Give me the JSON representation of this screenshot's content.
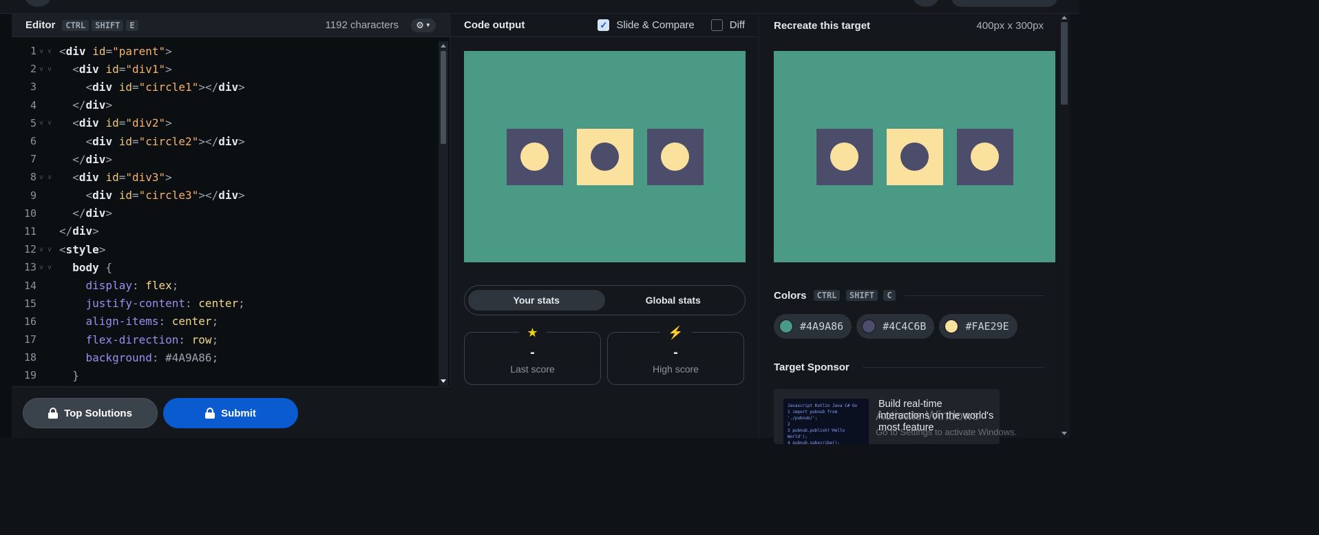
{
  "editor": {
    "title": "Editor",
    "shortcut": [
      "CTRL",
      "SHIFT",
      "E"
    ],
    "char_count": "1192 characters",
    "settings_icon": "gear-icon"
  },
  "code_lines": [
    {
      "n": "1",
      "fold": true,
      "tokens": [
        [
          "punct",
          "<"
        ],
        [
          "tag",
          "div"
        ],
        [
          "punct",
          " "
        ],
        [
          "attr",
          "id"
        ],
        [
          "punct",
          "="
        ],
        [
          "str",
          "\"parent\""
        ],
        [
          "punct",
          ">"
        ]
      ]
    },
    {
      "n": "2",
      "fold": true,
      "tokens": [
        [
          "punct",
          "  <"
        ],
        [
          "tag",
          "div"
        ],
        [
          "punct",
          " "
        ],
        [
          "attr",
          "id"
        ],
        [
          "punct",
          "="
        ],
        [
          "str",
          "\"div1\""
        ],
        [
          "punct",
          ">"
        ]
      ]
    },
    {
      "n": "3",
      "fold": false,
      "tokens": [
        [
          "punct",
          "    <"
        ],
        [
          "tag",
          "div"
        ],
        [
          "punct",
          " "
        ],
        [
          "attr",
          "id"
        ],
        [
          "punct",
          "="
        ],
        [
          "str",
          "\"circle1\""
        ],
        [
          "punct",
          "></"
        ],
        [
          "tag",
          "div"
        ],
        [
          "punct",
          ">"
        ]
      ]
    },
    {
      "n": "4",
      "fold": false,
      "tokens": [
        [
          "punct",
          "  </"
        ],
        [
          "tag",
          "div"
        ],
        [
          "punct",
          ">"
        ]
      ]
    },
    {
      "n": "5",
      "fold": true,
      "tokens": [
        [
          "punct",
          "  <"
        ],
        [
          "tag",
          "div"
        ],
        [
          "punct",
          " "
        ],
        [
          "attr",
          "id"
        ],
        [
          "punct",
          "="
        ],
        [
          "str",
          "\"div2\""
        ],
        [
          "punct",
          ">"
        ]
      ]
    },
    {
      "n": "6",
      "fold": false,
      "tokens": [
        [
          "punct",
          "    <"
        ],
        [
          "tag",
          "div"
        ],
        [
          "punct",
          " "
        ],
        [
          "attr",
          "id"
        ],
        [
          "punct",
          "="
        ],
        [
          "str",
          "\"circle2\""
        ],
        [
          "punct",
          "></"
        ],
        [
          "tag",
          "div"
        ],
        [
          "punct",
          ">"
        ]
      ]
    },
    {
      "n": "7",
      "fold": false,
      "tokens": [
        [
          "punct",
          "  </"
        ],
        [
          "tag",
          "div"
        ],
        [
          "punct",
          ">"
        ]
      ]
    },
    {
      "n": "8",
      "fold": true,
      "tokens": [
        [
          "punct",
          "  <"
        ],
        [
          "tag",
          "div"
        ],
        [
          "punct",
          " "
        ],
        [
          "attr",
          "id"
        ],
        [
          "punct",
          "="
        ],
        [
          "str",
          "\"div3\""
        ],
        [
          "punct",
          ">"
        ]
      ]
    },
    {
      "n": "9",
      "fold": false,
      "tokens": [
        [
          "punct",
          "    <"
        ],
        [
          "tag",
          "div"
        ],
        [
          "punct",
          " "
        ],
        [
          "attr",
          "id"
        ],
        [
          "punct",
          "="
        ],
        [
          "str",
          "\"circle3\""
        ],
        [
          "punct",
          "></"
        ],
        [
          "tag",
          "div"
        ],
        [
          "punct",
          ">"
        ]
      ]
    },
    {
      "n": "10",
      "fold": false,
      "tokens": [
        [
          "punct",
          "  </"
        ],
        [
          "tag",
          "div"
        ],
        [
          "punct",
          ">"
        ]
      ]
    },
    {
      "n": "11",
      "fold": false,
      "tokens": [
        [
          "punct",
          "</"
        ],
        [
          "tag",
          "div"
        ],
        [
          "punct",
          ">"
        ]
      ]
    },
    {
      "n": "12",
      "fold": true,
      "tokens": [
        [
          "punct",
          "<"
        ],
        [
          "tag",
          "style"
        ],
        [
          "punct",
          ">"
        ]
      ]
    },
    {
      "n": "13",
      "fold": true,
      "tokens": [
        [
          "punct",
          "  "
        ],
        [
          "sel",
          "body"
        ],
        [
          "punct",
          " {"
        ]
      ]
    },
    {
      "n": "14",
      "fold": false,
      "tokens": [
        [
          "punct",
          "    "
        ],
        [
          "prop",
          "display"
        ],
        [
          "punct",
          ": "
        ],
        [
          "val",
          "flex"
        ],
        [
          "punct",
          ";"
        ]
      ]
    },
    {
      "n": "15",
      "fold": false,
      "tokens": [
        [
          "punct",
          "    "
        ],
        [
          "prop",
          "justify-content"
        ],
        [
          "punct",
          ": "
        ],
        [
          "val",
          "center"
        ],
        [
          "punct",
          ";"
        ]
      ]
    },
    {
      "n": "16",
      "fold": false,
      "tokens": [
        [
          "punct",
          "    "
        ],
        [
          "prop",
          "align-items"
        ],
        [
          "punct",
          ": "
        ],
        [
          "val",
          "center"
        ],
        [
          "punct",
          ";"
        ]
      ]
    },
    {
      "n": "17",
      "fold": false,
      "tokens": [
        [
          "punct",
          "    "
        ],
        [
          "prop",
          "flex-direction"
        ],
        [
          "punct",
          ": "
        ],
        [
          "val",
          "row"
        ],
        [
          "punct",
          ";"
        ]
      ]
    },
    {
      "n": "18",
      "fold": false,
      "tokens": [
        [
          "punct",
          "    "
        ],
        [
          "prop",
          "background"
        ],
        [
          "punct",
          ": "
        ],
        [
          "punct",
          "#4A9A86"
        ],
        [
          "punct",
          ";"
        ]
      ]
    },
    {
      "n": "19",
      "fold": false,
      "tokens": [
        [
          "punct",
          "  }"
        ]
      ]
    }
  ],
  "footer": {
    "top_solutions": "Top Solutions",
    "submit": "Submit",
    "lock_icon": "lock-icon"
  },
  "output": {
    "title": "Code output",
    "slide_compare": "Slide & Compare",
    "slide_compare_checked": true,
    "diff": "Diff",
    "diff_checked": false
  },
  "stage": {
    "background": "#4A9A86",
    "squares": [
      {
        "bg": "#4C4C6B",
        "dot": "#FAE29E"
      },
      {
        "bg": "#FAE29E",
        "dot": "#4C4C6B"
      },
      {
        "bg": "#4C4C6B",
        "dot": "#FAE29E"
      }
    ]
  },
  "stats": {
    "your_stats": "Your stats",
    "global_stats": "Global stats",
    "last_score_value": "-",
    "last_score_label": "Last score",
    "high_score_value": "-",
    "high_score_label": "High score",
    "last_icon": "star-icon",
    "high_icon": "lightning-icon"
  },
  "target": {
    "title": "Recreate this target",
    "size": "400px x 300px",
    "colors_title": "Colors",
    "colors_shortcut": [
      "CTRL",
      "SHIFT",
      "C"
    ],
    "colors": [
      "#4A9A86",
      "#4C4C6B",
      "#FAE29E"
    ],
    "sponsor_title": "Target Sponsor",
    "sponsor_text": "Build real-time interactions on the world's most feature",
    "sponsor_code": [
      "Javascript  Kotlin  Java  C#  Go",
      "1  import pubnub from './pubnub/';",
      "2",
      "3  pubnub.publish('Hello World');",
      "4  pubnub.subscribe();"
    ]
  },
  "watermark": {
    "line1": "Activate Windows",
    "line2": "Go to Settings to activate Windows."
  }
}
